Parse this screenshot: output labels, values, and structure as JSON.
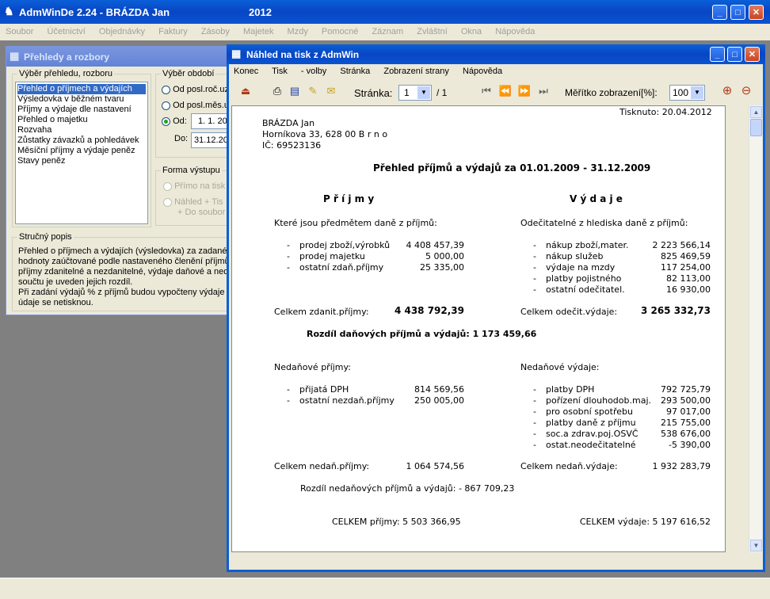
{
  "main_window": {
    "title": "AdmWinDe 2.24 - BRÁZDA Jan",
    "year": "2012",
    "menu": [
      "Soubor",
      "Účetnictví",
      "Objednávky",
      "Faktury",
      "Zásoby",
      "Majetek",
      "Mzdy",
      "Pomocné",
      "Záznam",
      "Zvláštní",
      "Okna",
      "Nápověda"
    ]
  },
  "reports_window": {
    "title": "Přehledy a rozbory",
    "selection_group": "Výběr přehledu, rozboru",
    "items": [
      "Přehled o příjmech a výdajích",
      "Výsledovka v běžném tvaru",
      "Příjmy a výdaje dle nastavení",
      "Přehled o majetku",
      "Rozvaha",
      "Zůstatky závazků a pohledávek",
      "Měsíční příjmy a výdaje peněz",
      "Stavy peněz"
    ],
    "period_group": "Výběr období",
    "period_opt1": "Od posl.roč.uz",
    "period_opt2": "Od posl.měs.u",
    "period_opt3": "Od:",
    "from_value": "1. 1. 20",
    "to_label": "Do:",
    "to_value": "31.12.20",
    "output_group": "Forma výstupu",
    "output_opt1": "Přímo na tisk",
    "output_opt2a": "Náhled + Tis",
    "output_opt2b": "+ Do soubor",
    "desc_group": "Stručný popis",
    "desc_lines": [
      "Přehled o příjmech a výdajích (výsledovka) za zadané o",
      "hodnoty zaúčtované podle nastaveného členění příjmů",
      "příjmy zdanitelné a nezdanitelné, výdaje daňové a neda",
      "součtu je uveden jejich rozdíl.",
      "Při zadání výdajů % z příjmů budou vypočteny výdaje tí",
      "údaje se netisknou."
    ]
  },
  "preview": {
    "title": "Náhled na tisk z AdmWin",
    "menu": [
      "Konec",
      "Tisk",
      "- volby",
      "Stránka",
      "Zobrazení strany",
      "Nápověda"
    ],
    "page_label": "Stránka:",
    "page_value": "1",
    "page_total": "/ 1",
    "zoom_label": "Měřítko zobrazení[%]:",
    "zoom_value": "100"
  },
  "document": {
    "printed": "Tisknuto: 20.04.2012",
    "name": "BRÁZDA Jan",
    "address": "Horníkova 33, 628 00  B r n o",
    "ico": "IČ: 69523136",
    "heading": "Přehled příjmů a výdajů za  01.01.2009 - 31.12.2009",
    "income_title": "P ř í j m y",
    "expense_title": "V ý d a j e",
    "income_taxable_label": "Které jsou předmětem daně z příjmů:",
    "expense_deductible_label": "Odečitatelné z hlediska daně z příjmů:",
    "income_taxable": [
      {
        "label": "prodej zboží,výrobků",
        "value": "4 408 457,39"
      },
      {
        "label": "prodej majetku",
        "value": "5 000,00"
      },
      {
        "label": "ostatní zdaň.příjmy",
        "value": "25 335,00"
      }
    ],
    "expense_deductible": [
      {
        "label": "nákup zboží,mater.",
        "value": "2 223 566,14"
      },
      {
        "label": "nákup služeb",
        "value": "825 469,59"
      },
      {
        "label": "výdaje na mzdy",
        "value": "117 254,00"
      },
      {
        "label": "platby pojistného",
        "value": "82 113,00"
      },
      {
        "label": "ostatní odečitatel.",
        "value": "16 930,00"
      }
    ],
    "income_taxable_total_label": "Celkem zdanit.příjmy:",
    "income_taxable_total": "4 438 792,39",
    "expense_deductible_total_label": "Celkem odečit.výdaje:",
    "expense_deductible_total": "3 265 332,73",
    "tax_diff": "Rozdíl daňových příjmů a výdajů: 1 173 459,66",
    "income_nontax_label": "Nedaňové příjmy:",
    "expense_nontax_label": "Nedaňové výdaje:",
    "income_nontax": [
      {
        "label": "přijatá DPH",
        "value": "814 569,56"
      },
      {
        "label": "ostatní nezdaň.příjmy",
        "value": "250 005,00"
      }
    ],
    "expense_nontax": [
      {
        "label": "platby DPH",
        "value": "792 725,79"
      },
      {
        "label": "pořízení dlouhodob.maj.",
        "value": "293 500,00"
      },
      {
        "label": "pro osobní spotřebu",
        "value": "97 017,00"
      },
      {
        "label": "platby daně z příjmu",
        "value": "215 755,00"
      },
      {
        "label": "soc.a zdrav.poj.OSVČ",
        "value": "538 676,00"
      },
      {
        "label": "ostat.neodečitatelné",
        "value": "-5 390,00"
      }
    ],
    "income_nontax_total_label": "Celkem nedaň.příjmy:",
    "income_nontax_total": "1 064 574,56",
    "expense_nontax_total_label": "Celkem nedaň.výdaje:",
    "expense_nontax_total": "1 932 283,79",
    "nontax_diff": "Rozdíl nedaňových příjmů a výdajů: - 867 709,23",
    "total_income": "CELKEM příjmy: 5 503 366,95",
    "total_expense": "CELKEM výdaje: 5 197 616,52"
  }
}
